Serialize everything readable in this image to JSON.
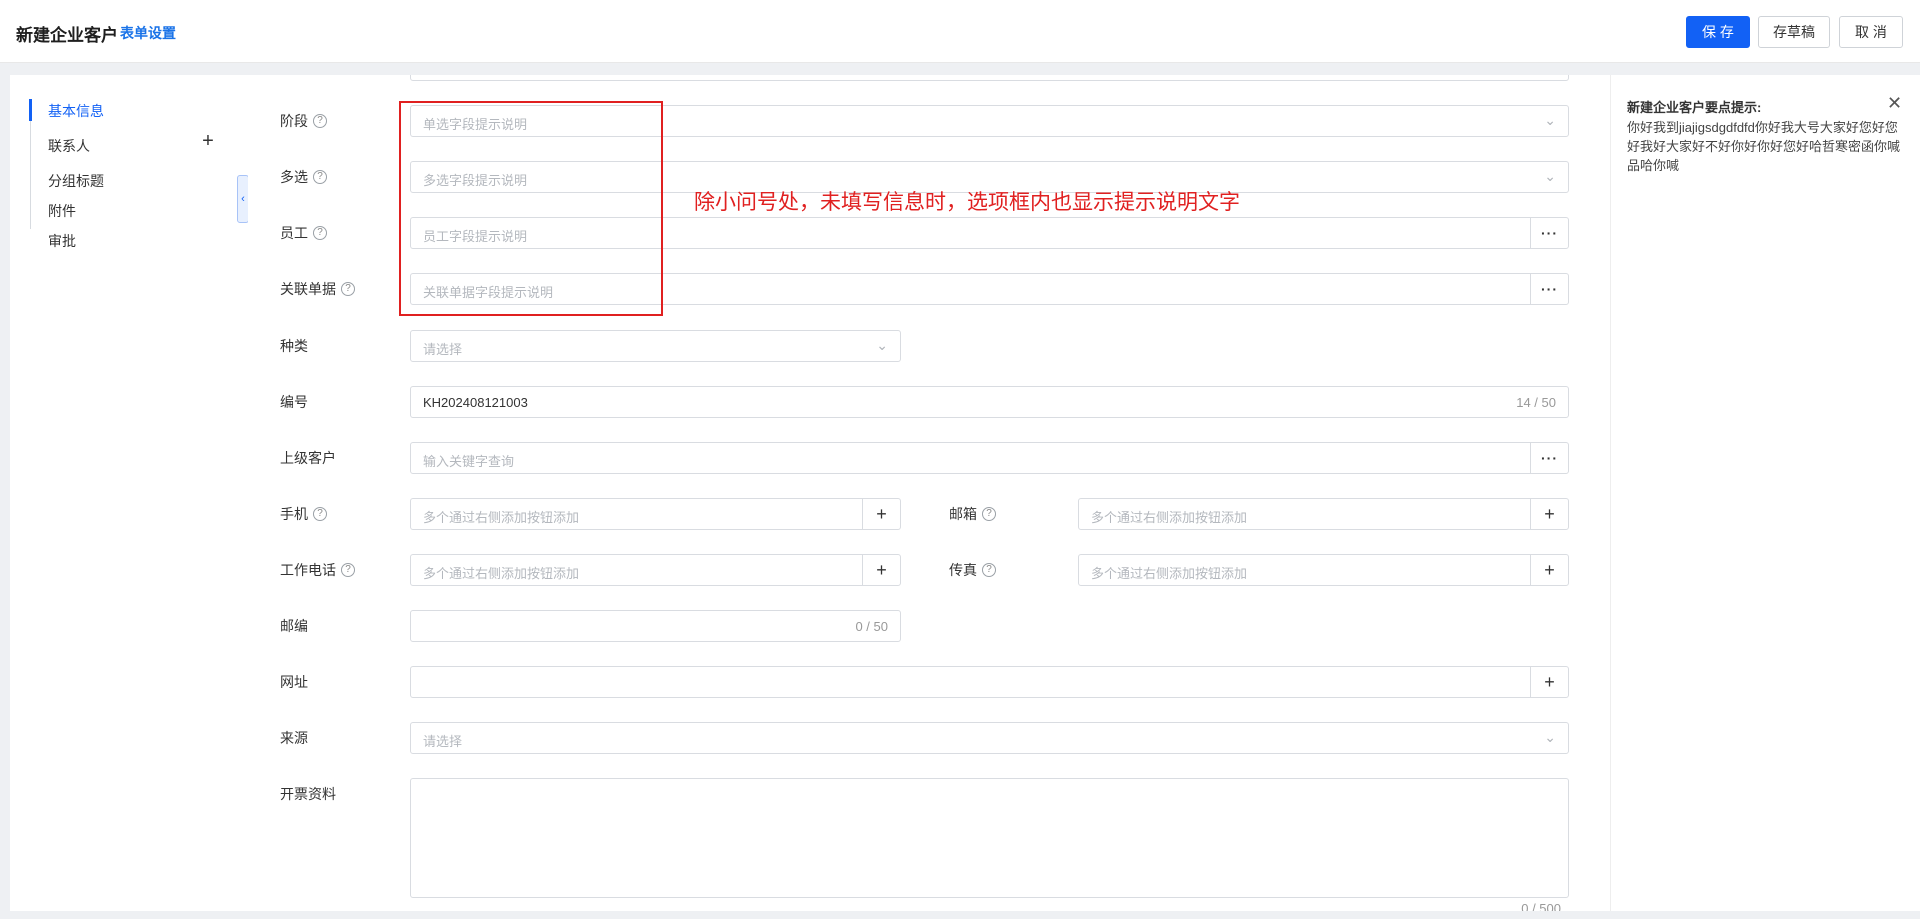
{
  "header": {
    "title": "新建企业客户",
    "form_settings": "表单设置",
    "save": "保 存",
    "draft": "存草稿",
    "cancel": "取 消"
  },
  "nav": {
    "items": [
      "基本信息",
      "联系人",
      "分组标题",
      "附件",
      "审批"
    ],
    "active": "基本信息"
  },
  "fields": {
    "stage": {
      "label": "阶段",
      "placeholder": "单选字段提示说明"
    },
    "multi": {
      "label": "多选",
      "placeholder": "多选字段提示说明"
    },
    "employee": {
      "label": "员工",
      "placeholder": "员工字段提示说明"
    },
    "linked_doc": {
      "label": "关联单据",
      "placeholder": "关联单据字段提示说明"
    },
    "category": {
      "label": "种类",
      "placeholder": "请选择"
    },
    "number": {
      "label": "编号",
      "value": "KH202408121003",
      "count": "14 / 50"
    },
    "parent_customer": {
      "label": "上级客户",
      "placeholder": "输入关键字查询"
    },
    "mobile": {
      "label": "手机",
      "placeholder": "多个通过右侧添加按钮添加"
    },
    "email": {
      "label": "邮箱",
      "placeholder": "多个通过右侧添加按钮添加"
    },
    "work_phone": {
      "label": "工作电话",
      "placeholder": "多个通过右侧添加按钮添加"
    },
    "fax": {
      "label": "传真",
      "placeholder": "多个通过右侧添加按钮添加"
    },
    "zipcode": {
      "label": "邮编",
      "count": "0 / 50"
    },
    "website": {
      "label": "网址"
    },
    "source": {
      "label": "来源",
      "placeholder": "请选择"
    },
    "invoice": {
      "label": "开票资料",
      "count": "0 / 500"
    }
  },
  "annotation": {
    "text": "除小问号处，未填写信息时，选项框内也显示提示说明文字",
    "color": "#e02020"
  },
  "tips": {
    "title": "新建企业客户要点提示:",
    "text": "你好我到jiajigsdgdfdfd你好我大号大家好您好您好我好大家好不好你好你好您好哈哲寒密函你喊品哈你喊"
  },
  "colors": {
    "primary": "#1261f5"
  }
}
